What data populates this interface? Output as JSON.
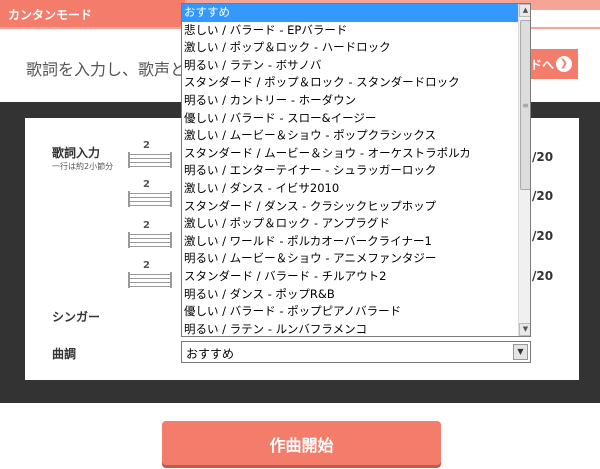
{
  "header": {
    "mode_tab": "カンタンモード"
  },
  "instruction": {
    "text": "歌詞を入力し、歌声と"
  },
  "next_button": {
    "label": "ドへ",
    "icon": "chevron-right-icon"
  },
  "form": {
    "lyrics_label": "歌詞入力",
    "lyrics_sub": "一行は約2小節分",
    "singer_label": "シンガー",
    "key_label": "曲調",
    "staff_number": "2",
    "counters": [
      "/20",
      "/20",
      "/20",
      "/20"
    ]
  },
  "key_select": {
    "value": "おすすめ",
    "options": [
      "おすすめ",
      "悲しい / バラード - EPバラード",
      "激しい / ポップ＆ロック - ハードロック",
      "明るい / ラテン - ボサノバ",
      "スタンダード / ポップ＆ロック - スタンダードロック",
      "明るい / カントリー - ホーダウン",
      "優しい / バラード - スロー&イージー",
      "激しい / ムービー＆ショウ - ポップクラシックス",
      "スタンダード / ムービー＆ショウ - オーケストラポルカ",
      "明るい / エンターテイナー - シュラッガーロック",
      "激しい / ダンス - イビサ2010",
      "スタンダード / ダンス - クラシックヒップホップ",
      "激しい / ポップ＆ロック - アンプラグド",
      "激しい / ワールド - ポルカオーバークライナー1",
      "明るい / ムービー＆ショウ - アニメファンタジー",
      "スタンダード / バラード - チルアウト2",
      "明るい / ダンス - ポップR&B",
      "優しい / バラード - ポップピアノバラード",
      "明るい / ラテン - ルンバフラメンコ"
    ],
    "selected_index": 0
  },
  "start_button": {
    "label": "作曲開始"
  },
  "colors": {
    "accent": "#f47c6b",
    "frame": "#333333",
    "selection": "#3399ff"
  }
}
